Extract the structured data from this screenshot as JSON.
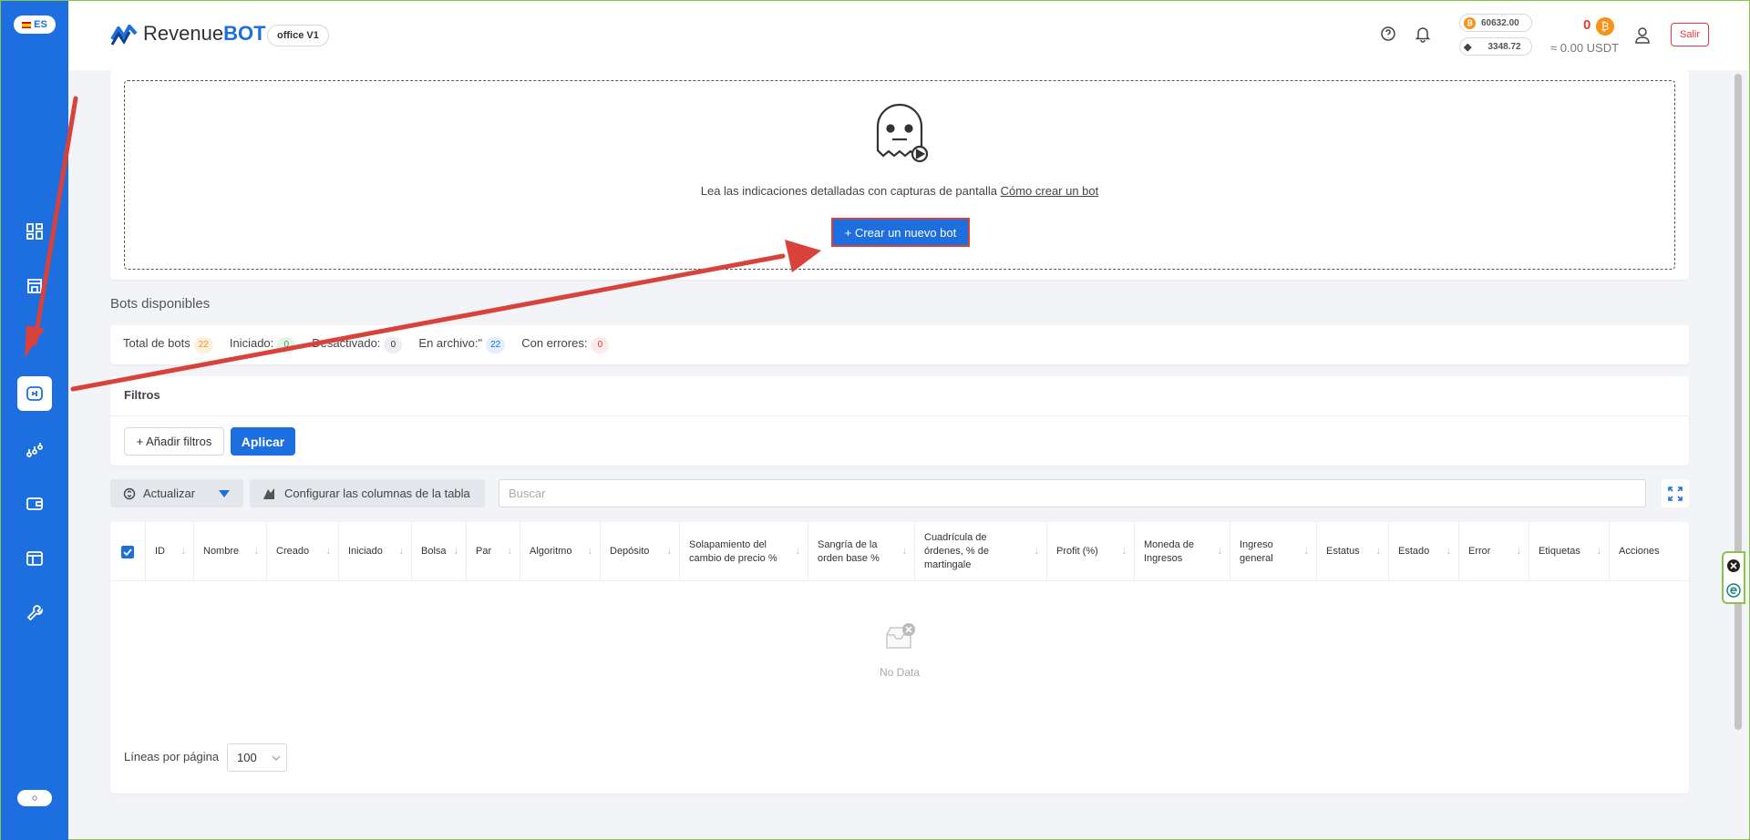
{
  "sidebar": {
    "lang": "ES",
    "items": [
      "dashboard-icon",
      "store-icon",
      "bot-icon",
      "chart-icon",
      "wallet-icon",
      "layout-icon",
      "wrench-icon"
    ]
  },
  "header": {
    "logo_pre": "Revenue",
    "logo_bold": "BOT",
    "office": "office V1",
    "btc_price": "60632.00",
    "eth_price": "3348.72",
    "balance": "0",
    "balance_usdt": "≈ 0.00 USDT",
    "logout": "Salir"
  },
  "create": {
    "hint": "Lea las indicaciones detalladas con capturas de pantalla",
    "link": "Cómo crear un bot",
    "button": "+ Crear un nuevo bot"
  },
  "bots_title": "Bots disponibles",
  "stats": [
    {
      "label": "Total de bots",
      "value": "22",
      "bg": "#fdf0dd",
      "fg": "#e8912b"
    },
    {
      "label": "Iniciado:",
      "value": "0",
      "bg": "#e3f5e6",
      "fg": "#43a047"
    },
    {
      "label": "Desactivado:",
      "value": "0",
      "bg": "#eceef1",
      "fg": "#333333"
    },
    {
      "label": "En archivo:\"",
      "value": "22",
      "bg": "#e3efff",
      "fg": "#1d6fe0"
    },
    {
      "label": "Con errores:",
      "value": "0",
      "bg": "#fdeaea",
      "fg": "#e53935"
    }
  ],
  "filters": {
    "title": "Filtros",
    "add": "+ Añadir filtros",
    "apply": "Aplicar"
  },
  "toolbar": {
    "refresh": "Actualizar",
    "configure": "Configurar las columnas de la tabla",
    "search_placeholder": "Buscar"
  },
  "table": {
    "columns": [
      "ID",
      "Nombre",
      "Creado",
      "Iniciado",
      "Bolsa",
      "Par",
      "Algoritmo",
      "Depósito",
      "Solapamiento del cambio de precio %",
      "Sangría de la orden base %",
      "Cuadrícula de órdenes, % de martingale",
      "Profit (%)",
      "Moneda de Ingresos",
      "Ingreso general",
      "Estatus",
      "Estado",
      "Error",
      "Etiquetas",
      "Acciones"
    ],
    "empty": "No Data",
    "per_page_label": "Líneas por página",
    "per_page_value": "100"
  }
}
